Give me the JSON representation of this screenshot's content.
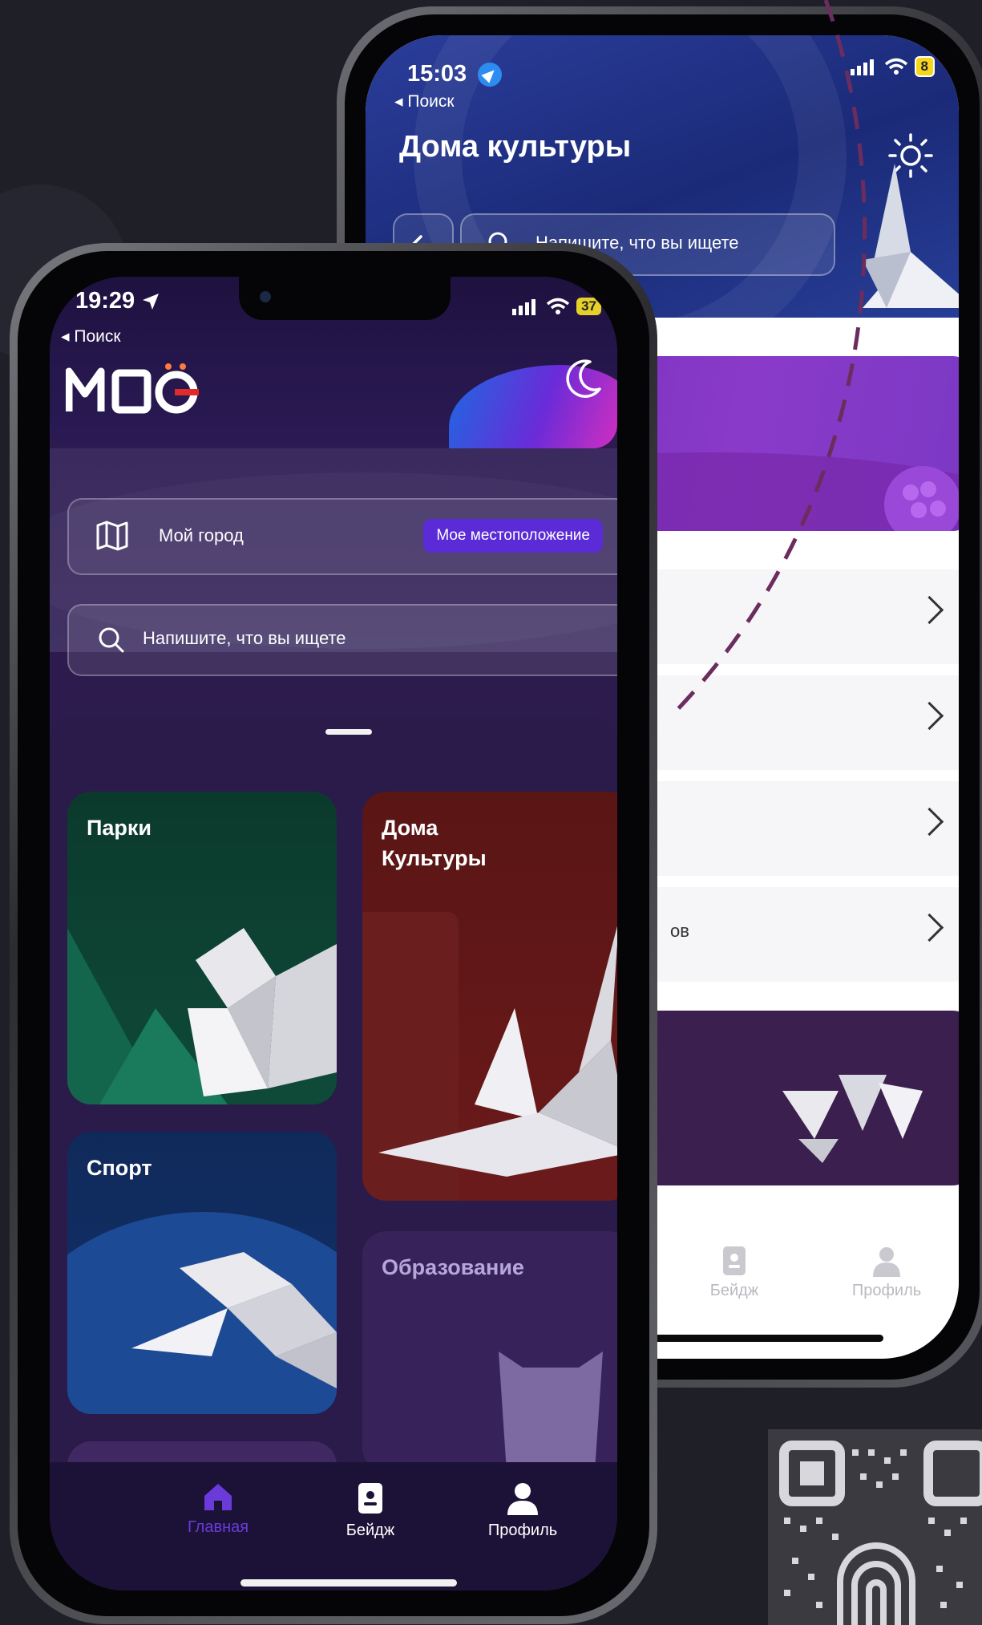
{
  "colors": {
    "background": "#1f1f27",
    "front_accent": "#5a2bd6",
    "dash_line": "#6b2d5e"
  },
  "back_phone": {
    "status": {
      "time": "15:03",
      "battery": "8"
    },
    "back_label": "◂ Поиск",
    "title": "Дома культуры",
    "search_placeholder": "Напишите, что вы ищете",
    "partial_row_text": "ов",
    "tabs": [
      {
        "label": "Бейдж",
        "icon": "badge-icon"
      },
      {
        "label": "Профиль",
        "icon": "profile-icon"
      }
    ]
  },
  "front_phone": {
    "status": {
      "time": "19:29",
      "battery": "37"
    },
    "back_label": "◂ Поиск",
    "logo_text": "МОЁ",
    "city": {
      "label": "Мой город",
      "location_button": "Мое местоположение"
    },
    "search_placeholder": "Напишите, что вы ищете",
    "cards": {
      "parks": "Парки",
      "culture": "Дома\nКультуры",
      "sport": "Спорт",
      "education": "Образование"
    },
    "tabs": [
      {
        "label": "Главная",
        "icon": "home-icon",
        "active": true
      },
      {
        "label": "Бейдж",
        "icon": "badge-icon",
        "active": false
      },
      {
        "label": "Профиль",
        "icon": "profile-icon",
        "active": false
      }
    ]
  }
}
